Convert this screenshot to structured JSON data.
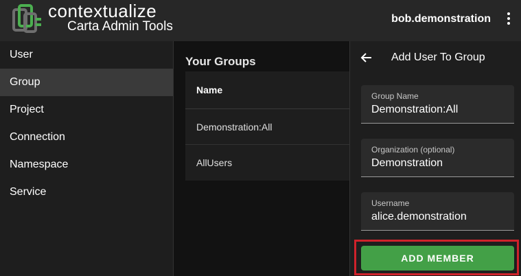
{
  "header": {
    "brand": "contextualize",
    "subtitle": "Carta Admin Tools",
    "username": "bob.demonstration",
    "logo_icon": "contextualize-logo-icon",
    "menu_icon": "more-vert-icon"
  },
  "sidebar": {
    "items": [
      {
        "label": "User",
        "active": false
      },
      {
        "label": "Group",
        "active": true
      },
      {
        "label": "Project",
        "active": false
      },
      {
        "label": "Connection",
        "active": false
      },
      {
        "label": "Namespace",
        "active": false
      },
      {
        "label": "Service",
        "active": false
      }
    ]
  },
  "main": {
    "title": "Your Groups",
    "table": {
      "header": "Name",
      "rows": [
        "Demonstration:All",
        "AllUsers"
      ]
    }
  },
  "panel": {
    "back_icon": "arrow-back-icon",
    "title": "Add User To Group",
    "fields": [
      {
        "label": "Group Name",
        "value": "Demonstration:All"
      },
      {
        "label": "Organization (optional)",
        "value": "Demonstration"
      },
      {
        "label": "Username",
        "value": "alice.demonstration"
      }
    ],
    "button": "ADD MEMBER"
  },
  "colors": {
    "accent_green": "#43a047",
    "highlight_red": "#d0222b",
    "logo_green": "#4caf50"
  }
}
